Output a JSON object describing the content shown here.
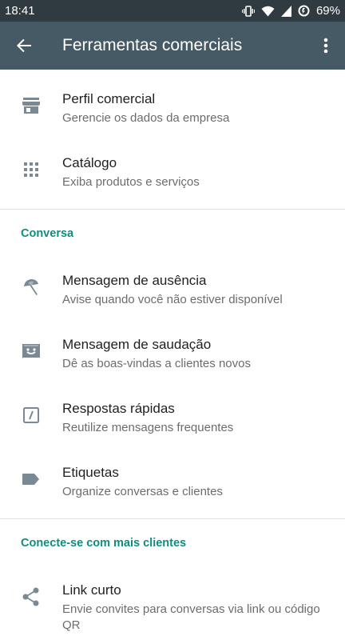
{
  "status": {
    "time": "18:41",
    "battery": "69%"
  },
  "appbar": {
    "title": "Ferramentas comerciais"
  },
  "sections": [
    {
      "items": [
        {
          "title": "Perfil comercial",
          "subtitle": "Gerencie os dados da empresa",
          "icon": "store-icon"
        },
        {
          "title": "Catálogo",
          "subtitle": "Exiba produtos e serviços",
          "icon": "grid-icon"
        }
      ]
    },
    {
      "header": "Conversa",
      "items": [
        {
          "title": "Mensagem de ausência",
          "subtitle": "Avise quando você não estiver disponível",
          "icon": "beach-umbrella-icon"
        },
        {
          "title": "Mensagem de saudação",
          "subtitle": "Dê as boas-vindas a clientes novos",
          "icon": "greeting-icon"
        },
        {
          "title": "Respostas rápidas",
          "subtitle": "Reutilize mensagens frequentes",
          "icon": "quick-reply-icon"
        },
        {
          "title": "Etiquetas",
          "subtitle": "Organize conversas e clientes",
          "icon": "label-icon"
        }
      ]
    },
    {
      "header": "Conecte-se com mais clientes",
      "items": [
        {
          "title": "Link curto",
          "subtitle": "Envie convites para conversas via link ou código QR",
          "icon": "share-icon"
        }
      ]
    }
  ],
  "colors": {
    "statusbar": "#2f3b41",
    "appbar": "#455a64",
    "accent": "#128c7e",
    "icon": "#7b8a92"
  }
}
